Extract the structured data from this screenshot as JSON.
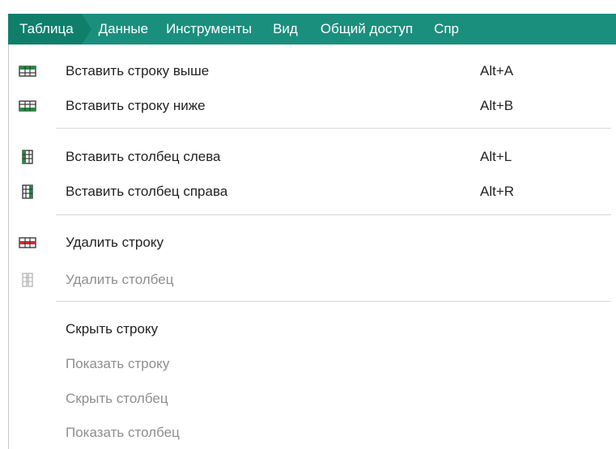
{
  "menubar": {
    "items": [
      {
        "label": "Таблица"
      },
      {
        "label": "Данные"
      },
      {
        "label": "Инструменты"
      },
      {
        "label": "Вид"
      },
      {
        "label": "Общий доступ"
      },
      {
        "label": "Спр"
      }
    ]
  },
  "menu": {
    "items": [
      {
        "label": "Вставить строку выше",
        "shortcut": "Alt+A",
        "icon": "insert-row-above-icon",
        "enabled": true
      },
      {
        "label": "Вставить строку ниже",
        "shortcut": "Alt+B",
        "icon": "insert-row-below-icon",
        "enabled": true
      },
      {
        "label": "Вставить столбец слева",
        "shortcut": "Alt+L",
        "icon": "insert-column-left-icon",
        "enabled": true
      },
      {
        "label": "Вставить столбец справа",
        "shortcut": "Alt+R",
        "icon": "insert-column-right-icon",
        "enabled": true
      },
      {
        "label": "Удалить строку",
        "shortcut": "",
        "icon": "delete-row-icon",
        "enabled": true
      },
      {
        "label": "Удалить столбец",
        "shortcut": "",
        "icon": "delete-column-icon",
        "enabled": false
      },
      {
        "label": "Скрыть строку",
        "shortcut": "",
        "icon": "",
        "enabled": true
      },
      {
        "label": "Показать строку",
        "shortcut": "",
        "icon": "",
        "enabled": false
      },
      {
        "label": "Скрыть столбец",
        "shortcut": "",
        "icon": "",
        "enabled": false
      },
      {
        "label": "Показать столбец",
        "shortcut": "",
        "icon": "",
        "enabled": false
      }
    ]
  },
  "colors": {
    "menubar_bg": "#1b8f7e",
    "menubar_active": "#0f7f6c",
    "icon_green": "#1e8c3a",
    "icon_red": "#d9262b",
    "text": "#222222",
    "disabled_text": "#8e8e8e"
  }
}
